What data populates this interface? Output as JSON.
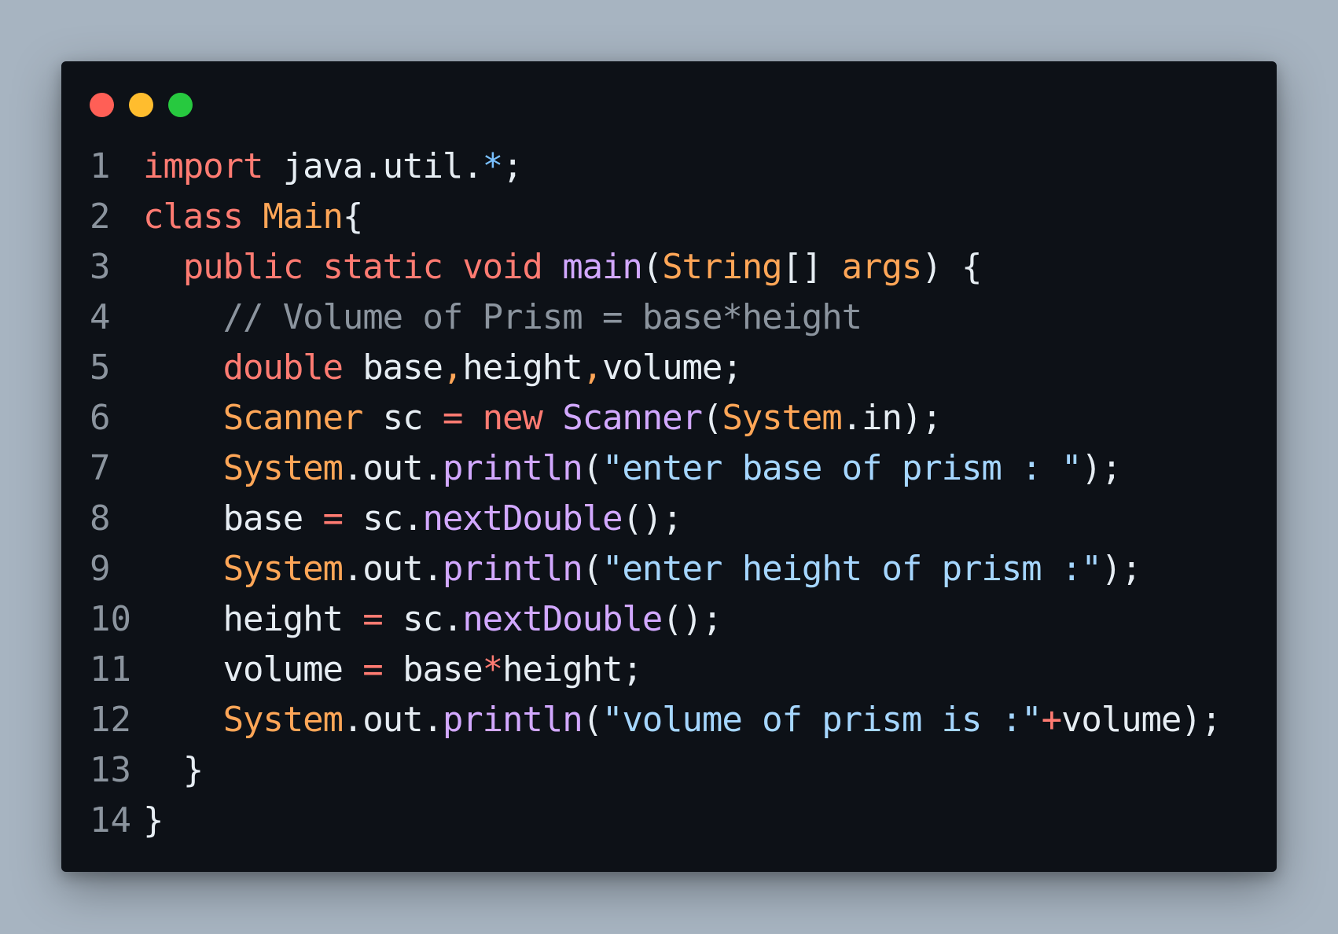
{
  "window": {
    "controls": [
      {
        "name": "close",
        "color": "#ff5f56"
      },
      {
        "name": "minimize",
        "color": "#ffbd2e"
      },
      {
        "name": "maximize",
        "color": "#27c93f"
      }
    ]
  },
  "colors": {
    "background": "#a7b4c1",
    "editor_background": "#0d1117",
    "line_number": "#8b949e",
    "keyword": "#ff7b72",
    "type": "#ffa657",
    "function": "#d2a8ff",
    "string": "#a5d6ff",
    "constant": "#79c0ff",
    "comment": "#8b949e",
    "plain": "#e6edf3"
  },
  "code": {
    "language": "java",
    "lines": [
      {
        "number": "1",
        "tokens": [
          {
            "text": "import",
            "kind": "keyword"
          },
          {
            "text": " java.util.",
            "kind": "plain"
          },
          {
            "text": "*",
            "kind": "constant"
          },
          {
            "text": ";",
            "kind": "plain"
          }
        ]
      },
      {
        "number": "2",
        "tokens": [
          {
            "text": "class",
            "kind": "keyword"
          },
          {
            "text": " ",
            "kind": "plain"
          },
          {
            "text": "Main",
            "kind": "type"
          },
          {
            "text": "{",
            "kind": "plain"
          }
        ]
      },
      {
        "number": "3",
        "tokens": [
          {
            "text": "  ",
            "kind": "plain"
          },
          {
            "text": "public",
            "kind": "keyword"
          },
          {
            "text": " ",
            "kind": "plain"
          },
          {
            "text": "static",
            "kind": "keyword"
          },
          {
            "text": " ",
            "kind": "plain"
          },
          {
            "text": "void",
            "kind": "keyword"
          },
          {
            "text": " ",
            "kind": "plain"
          },
          {
            "text": "main",
            "kind": "function"
          },
          {
            "text": "(",
            "kind": "plain"
          },
          {
            "text": "String",
            "kind": "type"
          },
          {
            "text": "[] ",
            "kind": "plain"
          },
          {
            "text": "args",
            "kind": "type"
          },
          {
            "text": ") {",
            "kind": "plain"
          }
        ]
      },
      {
        "number": "4",
        "tokens": [
          {
            "text": "    ",
            "kind": "plain"
          },
          {
            "text": "// Volume of Prism = base*height",
            "kind": "comment"
          }
        ]
      },
      {
        "number": "5",
        "tokens": [
          {
            "text": "    ",
            "kind": "plain"
          },
          {
            "text": "double",
            "kind": "keyword"
          },
          {
            "text": " base",
            "kind": "plain"
          },
          {
            "text": ",",
            "kind": "type"
          },
          {
            "text": "height",
            "kind": "plain"
          },
          {
            "text": ",",
            "kind": "type"
          },
          {
            "text": "volume;",
            "kind": "plain"
          }
        ]
      },
      {
        "number": "6",
        "tokens": [
          {
            "text": "    ",
            "kind": "plain"
          },
          {
            "text": "Scanner",
            "kind": "type"
          },
          {
            "text": " sc ",
            "kind": "plain"
          },
          {
            "text": "=",
            "kind": "keyword"
          },
          {
            "text": " ",
            "kind": "plain"
          },
          {
            "text": "new",
            "kind": "keyword"
          },
          {
            "text": " ",
            "kind": "plain"
          },
          {
            "text": "Scanner",
            "kind": "function"
          },
          {
            "text": "(",
            "kind": "plain"
          },
          {
            "text": "System",
            "kind": "type"
          },
          {
            "text": ".in);",
            "kind": "plain"
          }
        ]
      },
      {
        "number": "7",
        "tokens": [
          {
            "text": "    ",
            "kind": "plain"
          },
          {
            "text": "System",
            "kind": "type"
          },
          {
            "text": ".out.",
            "kind": "plain"
          },
          {
            "text": "println",
            "kind": "function"
          },
          {
            "text": "(",
            "kind": "plain"
          },
          {
            "text": "\"enter base of prism : \"",
            "kind": "string"
          },
          {
            "text": ");",
            "kind": "plain"
          }
        ]
      },
      {
        "number": "8",
        "tokens": [
          {
            "text": "    base ",
            "kind": "plain"
          },
          {
            "text": "=",
            "kind": "keyword"
          },
          {
            "text": " sc.",
            "kind": "plain"
          },
          {
            "text": "nextDouble",
            "kind": "function"
          },
          {
            "text": "();",
            "kind": "plain"
          }
        ]
      },
      {
        "number": "9",
        "tokens": [
          {
            "text": "    ",
            "kind": "plain"
          },
          {
            "text": "System",
            "kind": "type"
          },
          {
            "text": ".out.",
            "kind": "plain"
          },
          {
            "text": "println",
            "kind": "function"
          },
          {
            "text": "(",
            "kind": "plain"
          },
          {
            "text": "\"enter height of prism :\"",
            "kind": "string"
          },
          {
            "text": ");",
            "kind": "plain"
          }
        ]
      },
      {
        "number": "10",
        "tokens": [
          {
            "text": "    height ",
            "kind": "plain"
          },
          {
            "text": "=",
            "kind": "keyword"
          },
          {
            "text": " sc.",
            "kind": "plain"
          },
          {
            "text": "nextDouble",
            "kind": "function"
          },
          {
            "text": "();",
            "kind": "plain"
          }
        ]
      },
      {
        "number": "11",
        "tokens": [
          {
            "text": "    volume ",
            "kind": "plain"
          },
          {
            "text": "=",
            "kind": "keyword"
          },
          {
            "text": " base",
            "kind": "plain"
          },
          {
            "text": "*",
            "kind": "keyword"
          },
          {
            "text": "height;",
            "kind": "plain"
          }
        ]
      },
      {
        "number": "12",
        "tokens": [
          {
            "text": "    ",
            "kind": "plain"
          },
          {
            "text": "System",
            "kind": "type"
          },
          {
            "text": ".out.",
            "kind": "plain"
          },
          {
            "text": "println",
            "kind": "function"
          },
          {
            "text": "(",
            "kind": "plain"
          },
          {
            "text": "\"volume of prism is :\"",
            "kind": "string"
          },
          {
            "text": "+",
            "kind": "keyword"
          },
          {
            "text": "volume);",
            "kind": "plain"
          }
        ]
      },
      {
        "number": "13",
        "tokens": [
          {
            "text": "  }",
            "kind": "plain"
          }
        ]
      },
      {
        "number": "14",
        "tokens": [
          {
            "text": "}",
            "kind": "plain"
          }
        ]
      }
    ]
  }
}
